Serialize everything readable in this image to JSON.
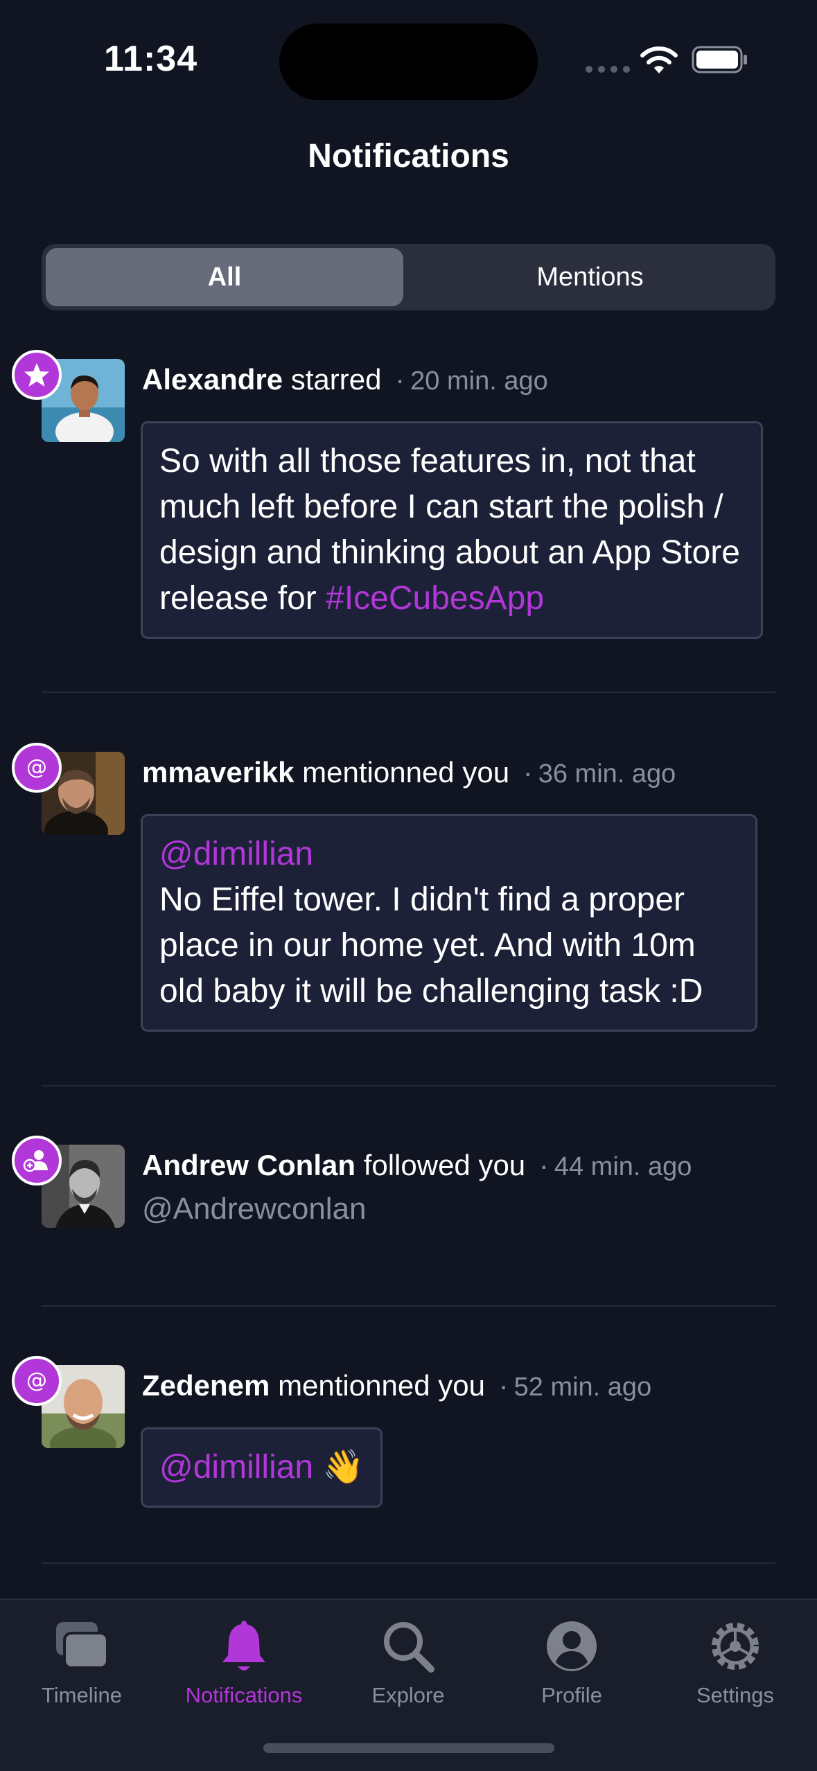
{
  "status_bar": {
    "time": "11:34"
  },
  "header": {
    "title": "Notifications"
  },
  "segments": {
    "all": "All",
    "mentions": "Mentions",
    "selected": "All"
  },
  "notifications": [
    {
      "type": "star",
      "type_icon": "star-icon",
      "name": "Alexandre",
      "action": "starred",
      "separator": "·",
      "time_ago": "20 min. ago",
      "content_text": "So with all those features in, not that much left before I can start the polish / design and thinking about an App Store release for ",
      "hashtag": "#IceCubesApp"
    },
    {
      "type": "mention",
      "type_icon": "at-icon",
      "name": "mmaverikk",
      "action": "mentionned you",
      "separator": "·",
      "time_ago": "36 min. ago",
      "mention": "@dimillian",
      "content_text": "No Eiffel tower. I didn't find a proper place in our home yet. And with 10m old baby it will be challenging task :D"
    },
    {
      "type": "follow",
      "type_icon": "person-add-icon",
      "name": "Andrew Conlan",
      "action": "followed you",
      "separator": "·",
      "time_ago": "44 min. ago",
      "handle": "@Andrewconlan"
    },
    {
      "type": "mention",
      "type_icon": "at-icon",
      "name": "Zedenem",
      "action": "mentionned you",
      "separator": "·",
      "time_ago": "52 min. ago",
      "mention": "@dimillian",
      "emoji": "👋"
    }
  ],
  "tab_bar": {
    "items": [
      {
        "label": "Timeline",
        "icon": "timeline-icon",
        "active": false
      },
      {
        "label": "Notifications",
        "icon": "bell-icon",
        "active": true
      },
      {
        "label": "Explore",
        "icon": "search-icon",
        "active": false
      },
      {
        "label": "Profile",
        "icon": "profile-icon",
        "active": false
      },
      {
        "label": "Settings",
        "icon": "gear-icon",
        "active": false
      }
    ]
  },
  "colors": {
    "background": "#111522",
    "accent": "#b237d9",
    "card_background": "#1d2138",
    "secondary_text": "#8a8f9c",
    "segment_selected": "#686c7a"
  }
}
